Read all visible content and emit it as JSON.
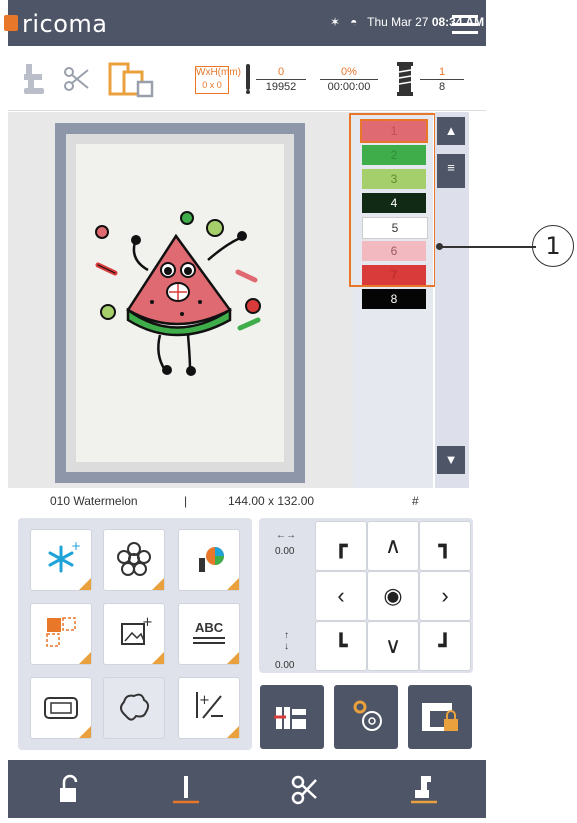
{
  "header": {
    "logo_text": "ricoma",
    "status_date": "Thu Mar 27",
    "status_time": "08:34 AM"
  },
  "toolbar": {
    "size_label": "WxH(mm)",
    "size_value": "0 x 0",
    "stitch_current": "0",
    "stitch_total": "19952",
    "progress_percent": "0%",
    "progress_time": "00:00:00",
    "color_current": "1",
    "color_total": "8"
  },
  "colors": [
    {
      "label": "1",
      "hex": "#e06a72",
      "text": "#c44a53"
    },
    {
      "label": "2",
      "hex": "#3fae4a",
      "text": "#2f8c38"
    },
    {
      "label": "3",
      "hex": "#a4cf6a",
      "text": "#5d8a2f"
    },
    {
      "label": "4",
      "hex": "#102a16",
      "text": "#ffffff"
    },
    {
      "label": "5",
      "hex": "#ffffff",
      "text": "#333333"
    },
    {
      "label": "6",
      "hex": "#f3b9c0",
      "text": "#9a5a60"
    },
    {
      "label": "7",
      "hex": "#d93a3a",
      "text": "#b52a2a"
    },
    {
      "label": "8",
      "hex": "#050505",
      "text": "#ffffff"
    }
  ],
  "callout": {
    "number": "1"
  },
  "info": {
    "design_name": "010 Watermelon",
    "separator": "|",
    "dimensions": "144.00 x 132.00",
    "hash": "#"
  },
  "dpad": {
    "x_value": "0.00",
    "y_value": "0.00"
  },
  "accent_color": "#e8772a",
  "dark_color": "#4e5566"
}
